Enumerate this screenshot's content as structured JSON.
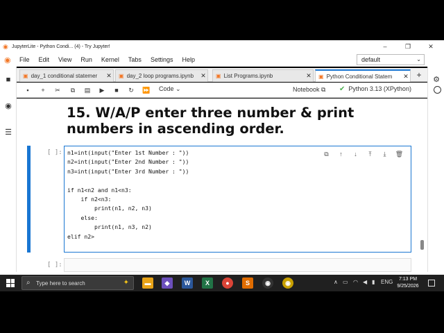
{
  "browser": {
    "title": "JupyterLite - Python Condi... (4) - Try Jupyter!",
    "minimize": "–",
    "maximize": "❐",
    "close": "✕"
  },
  "menu": {
    "items": [
      "File",
      "Edit",
      "View",
      "Run",
      "Kernel",
      "Tabs",
      "Settings",
      "Help"
    ],
    "kernel_select": "default"
  },
  "tabs": [
    {
      "label": "day_1 conditional statemer",
      "active": false
    },
    {
      "label": "day_2 loop programs.ipynb",
      "active": false
    },
    {
      "label": "List Programs.ipynb",
      "active": false
    },
    {
      "label": "Python Conditional Statem",
      "active": true
    }
  ],
  "toolbar": {
    "cell_type": "Code",
    "notebook_label": "Notebook",
    "kernel_name": "Python 3.13 (XPython)"
  },
  "notebook": {
    "heading": "15. W/A/P enter three number & print numbers in ascending order.",
    "cell_prompt": "[ ]:",
    "empty_prompt": "[ ]:",
    "code_lines": [
      "n1=int(input(\"Enter 1st Number : \"))",
      "n2=int(input(\"Enter 2nd Number : \"))",
      "n3=int(input(\"Enter 3rd Number : \"))",
      "",
      "if n1<n2 and n1<n3:",
      "    if n2<n3:",
      "        print(n1, n2, n3)",
      "    else:",
      "        print(n1, n3, n2)",
      "elif n2>"
    ]
  },
  "taskbar": {
    "search_placeholder": "Type here to search",
    "language": "ENG",
    "time": "7:13 PM",
    "date": "9/25/2026"
  }
}
